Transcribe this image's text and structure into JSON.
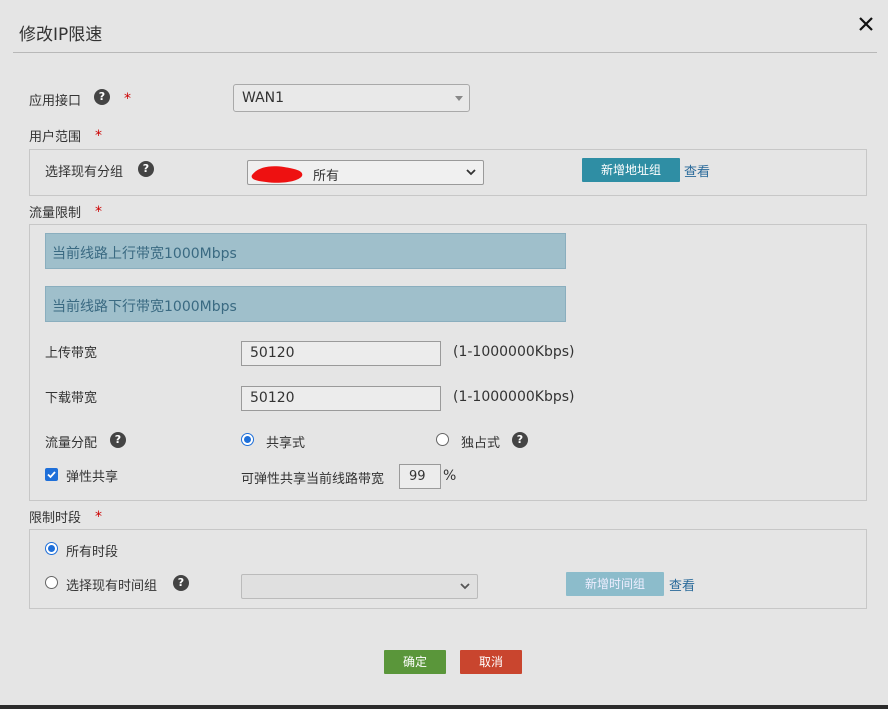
{
  "dialog": {
    "title": "修改IP限速"
  },
  "interface": {
    "label": "应用接口",
    "required_mark": "*",
    "value": "WAN1"
  },
  "user_scope": {
    "label": "用户范围",
    "required_mark": "*",
    "group_label": "选择现有分组",
    "group_value": "所有",
    "add_group_button": "新增地址组",
    "view_link": "查看"
  },
  "traffic": {
    "label": "流量限制",
    "required_mark": "*",
    "uplink_info": "当前线路上行带宽1000Mbps",
    "downlink_info": "当前线路下行带宽1000Mbps",
    "upload_label": "上传带宽",
    "upload_value": "50120",
    "upload_range": "(1-1000000Kbps)",
    "download_label": "下载带宽",
    "download_value": "50120",
    "download_range": "(1-1000000Kbps)",
    "allocation_label": "流量分配",
    "shared_label": "共享式",
    "exclusive_label": "独占式",
    "elastic_label": "弹性共享",
    "elastic_desc": "可弹性共享当前线路带宽",
    "elastic_value": "99",
    "elastic_unit": "%"
  },
  "time": {
    "label": "限制时段",
    "required_mark": "*",
    "all_label": "所有时段",
    "group_label": "选择现有时间组",
    "group_value": "",
    "add_time_button": "新增时间组",
    "view_link": "查看"
  },
  "footer": {
    "ok": "确定",
    "cancel": "取消"
  },
  "colors": {
    "accent": "#2f8ea4",
    "ok": "#5a963a",
    "cancel": "#c9452e",
    "required": "#cc0000"
  }
}
